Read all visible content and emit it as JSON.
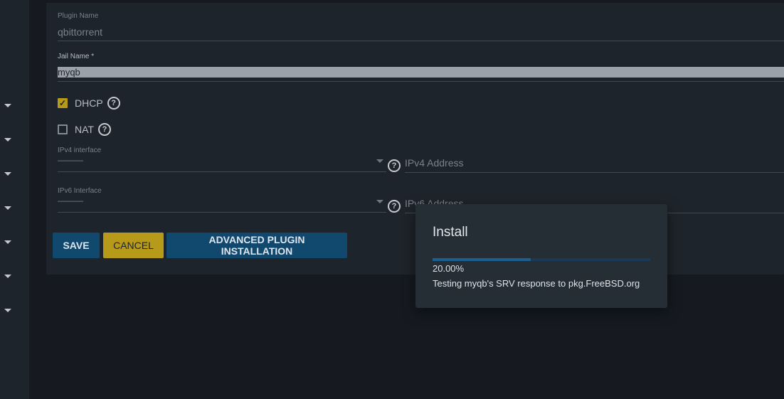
{
  "form": {
    "plugin_name": {
      "label": "Plugin Name",
      "value": "qbittorrent"
    },
    "jail_name": {
      "label": "Jail Name *",
      "value": "myqb"
    },
    "dhcp": {
      "label": "DHCP",
      "checked": true
    },
    "nat": {
      "label": "NAT",
      "checked": false
    },
    "ipv4_interface": {
      "label": "IPv4 interface",
      "value": "———"
    },
    "ipv4_address": {
      "placeholder": "IPv4 Address"
    },
    "ipv6_interface": {
      "label": "IPv6 Interface",
      "value": "———"
    },
    "ipv6_address": {
      "placeholder": "IPv6 Address"
    },
    "help_glyph": "?"
  },
  "buttons": {
    "save": "SAVE",
    "cancel": "CANCEL",
    "advanced": "ADVANCED PLUGIN INSTALLATION"
  },
  "dialog": {
    "title": "Install",
    "progress": 0.2,
    "percent_text": "20.00%",
    "message": "Testing myqb's SRV response to pkg.FreeBSD.org"
  },
  "colors": {
    "accent_yellow": "#b79a1a",
    "primary_blue": "#10486e",
    "progress_fill": "#1a5f92"
  }
}
